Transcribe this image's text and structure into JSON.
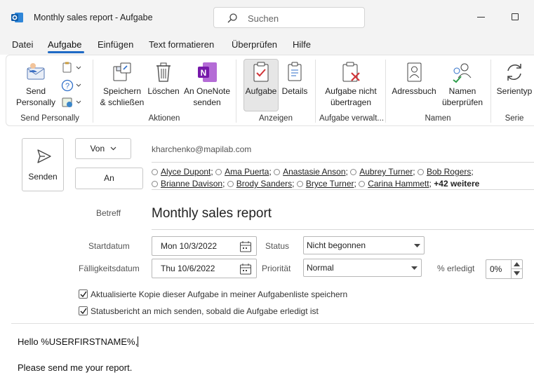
{
  "window": {
    "title": "Monthly sales report  -  Aufgabe",
    "search_placeholder": "Suchen"
  },
  "menu": {
    "items": [
      "Datei",
      "Aufgabe",
      "Einfügen",
      "Text formatieren",
      "Überprüfen",
      "Hilfe"
    ],
    "active": "Aufgabe"
  },
  "ribbon": {
    "send_personally": "Send\nPersonally",
    "group_send_personally": "Send Personally",
    "save_close": "Speichern\n& schließen",
    "delete": "Löschen",
    "onenote": "An OneNote\nsenden",
    "group_actions": "Aktionen",
    "task": "Aufgabe",
    "details": "Details",
    "group_views": "Anzeigen",
    "no_transfer": "Aufgabe nicht\nübertragen",
    "group_manage": "Aufgabe verwalt...",
    "address_book": "Adressbuch",
    "check_names": "Namen\nüberprüfen",
    "group_names": "Namen",
    "recurrence": "Serientyp",
    "group_series": "Serie"
  },
  "form": {
    "send_label": "Senden",
    "from_label": "Von",
    "to_label": "An",
    "from_email": "kharchenko@mapilab.com",
    "recipients_line1": [
      "Alyce Dupont",
      "Ama Puerta",
      "Anastasie Anson",
      "Aubrey Turner",
      "Bob Rogers"
    ],
    "recipients_line2": [
      "Brianne Davison",
      "Brody Sanders",
      "Bryce Turner",
      "Carina Hammett"
    ],
    "more_label": "+42 weitere",
    "subject_label": "Betreff",
    "subject": "Monthly sales report",
    "start_label": "Startdatum",
    "start_date": "Mon 10/3/2022",
    "due_label": "Fälligkeitsdatum",
    "due_date": "Thu 10/6/2022",
    "status_label": "Status",
    "status_value": "Nicht begonnen",
    "priority_label": "Priorität",
    "priority_value": "Normal",
    "percent_label": "% erledigt",
    "percent_value": "0%",
    "checkbox1_label": "Aktualisierte Kopie dieser Aufgabe in meiner Aufgabenliste speichern",
    "checkbox1_checked": true,
    "checkbox2_label": "Statusbericht an mich senden, sobald die Aufgabe erledigt ist",
    "checkbox2_checked": true
  },
  "body": {
    "line1": "Hello %USERFIRSTNAME%,",
    "line2": "Please send me your report."
  }
}
